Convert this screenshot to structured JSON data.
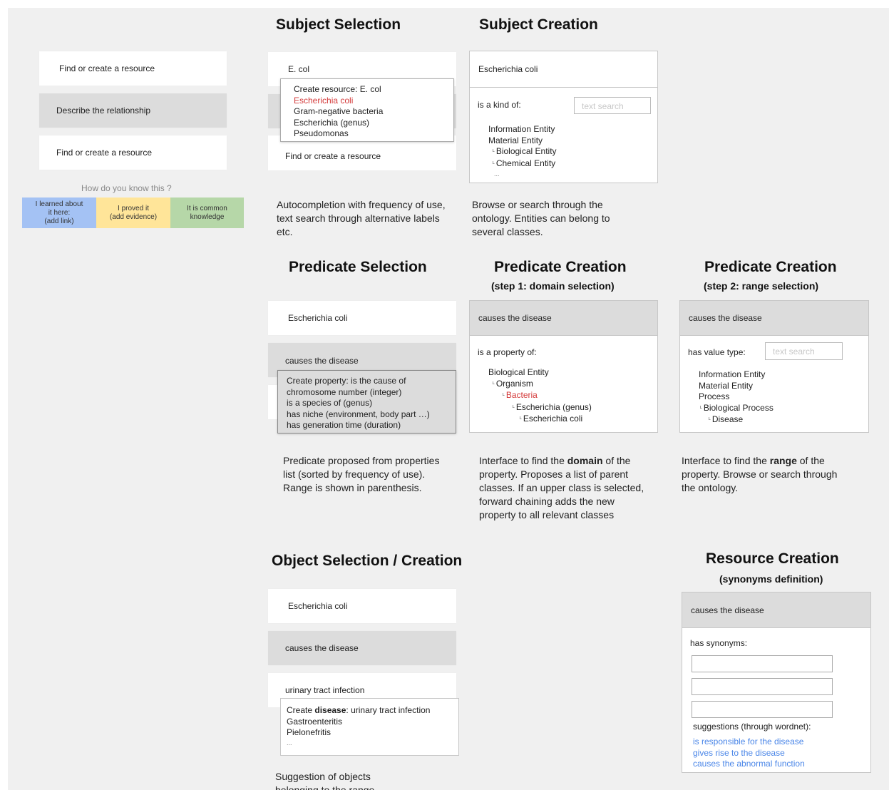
{
  "left_panel": {
    "card1": "Find or create a resource",
    "card2": "Describe the relationship",
    "card3": "Find or create a resource",
    "question": "How do you know this ?",
    "evidence": [
      {
        "line1": "I learned about",
        "line2": "it here:",
        "line3": "(add link)",
        "color": "#a4c2f4"
      },
      {
        "line1": "I proved it",
        "line2": "(add evidence)",
        "color": "#ffe599"
      },
      {
        "line1": "It is common",
        "line2": "knowledge",
        "color": "#b6d7a8"
      }
    ]
  },
  "subject_selection": {
    "title": "Subject Selection",
    "input_value": "E. col",
    "dropdown": [
      "Create resource: E. col",
      "Escherichia coli",
      "Gram-negative bacteria",
      "Escherichia (genus)",
      "Pseudomonas"
    ],
    "bottom_card": "Find or create a resource",
    "description": "Autocompletion with frequency of use, text search through alternative labels etc."
  },
  "subject_creation": {
    "title": "Subject Creation",
    "header": "Escherichia coli",
    "label": "is a kind of:",
    "search_placeholder": "text search",
    "tree": [
      "Information Entity",
      "Material Entity",
      "Biological Entity",
      "Chemical Entity",
      "..."
    ],
    "description": "Browse or search through the ontology. Entities can belong to several classes."
  },
  "predicate_selection": {
    "title": "Predicate Selection",
    "card1": "Escherichia coli",
    "card2": "causes the disease",
    "dropdown": [
      "Create property: is the cause of",
      "chromosome number (integer)",
      "is a species of (genus)",
      "has niche (environment, body part …)",
      "has generation time (duration)"
    ],
    "description": "Predicate proposed from properties list (sorted by frequency of use). Range is shown in parenthesis."
  },
  "predicate_creation_domain": {
    "title": "Predicate Creation",
    "subtitle": "(step 1: domain selection)",
    "header": "causes the disease",
    "label": "is a property of:",
    "tree": [
      "Biological Entity",
      "Organism",
      "Bacteria",
      "Escherichia (genus)",
      "Escherichia coli"
    ],
    "description_pre": "Interface to find the ",
    "description_bold": "domain",
    "description_post": " of the property. Proposes a list of parent classes. If an upper class is selected, forward chaining adds the new property to all relevant classes"
  },
  "predicate_creation_range": {
    "title": "Predicate Creation",
    "subtitle": "(step 2: range selection)",
    "header": "causes the disease",
    "label": "has value type:",
    "search_placeholder": "text search",
    "tree": [
      "Information Entity",
      "Material Entity",
      "Process",
      "Biological Process",
      "Disease"
    ],
    "description_pre": "Interface to find the ",
    "description_bold": "range",
    "description_post": " of the property. Browse or search through the ontology."
  },
  "object_selection": {
    "title": "Object Selection / Creation",
    "card1": "Escherichia coli",
    "card2": "causes the disease",
    "card3": "urinary tract infection",
    "dropdown_create_pre": "Create ",
    "dropdown_create_bold": "disease",
    "dropdown_create_post": ": urinary tract infection",
    "dropdown": [
      "Gastroenteritis",
      "Pielonefritis",
      "..."
    ],
    "description": "Suggestion of objects belonging to the range"
  },
  "resource_creation": {
    "title": "Resource Creation",
    "subtitle": "(synonyms definition)",
    "header": "causes the disease",
    "label": "has synonyms:",
    "suggestions_label": "suggestions (through wordnet):",
    "suggestions": [
      "is responsible for the disease",
      "gives rise to the disease",
      "causes the abnormal function"
    ]
  },
  "colors": {
    "background": "#f0f0f0",
    "card_grey": "#dcdcdc",
    "highlight_red": "#d43a3a",
    "link_blue": "#4a86e8"
  }
}
